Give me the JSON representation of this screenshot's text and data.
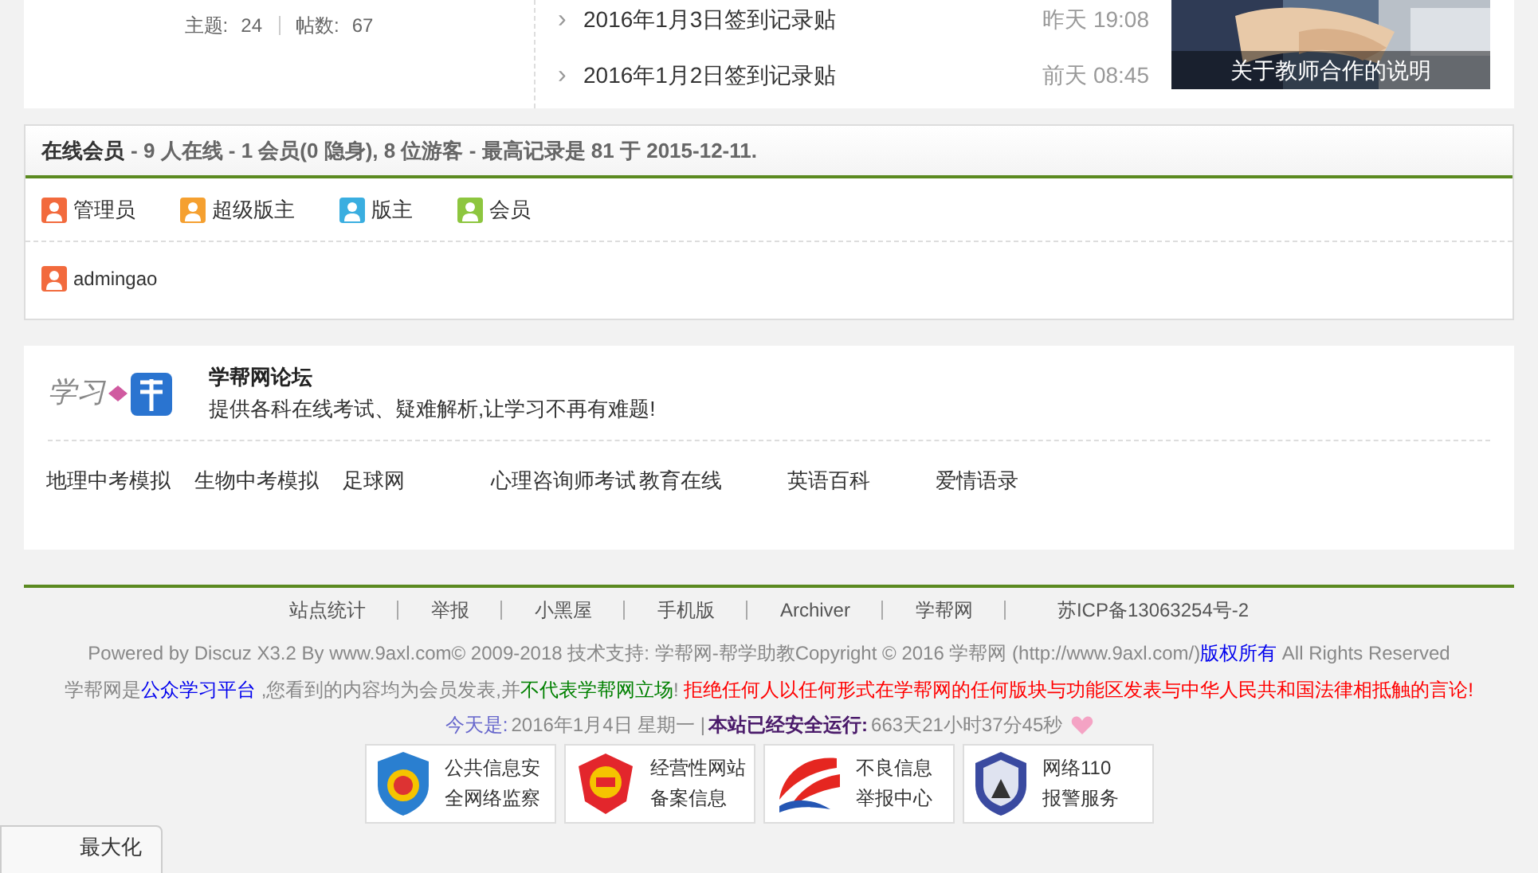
{
  "forum_stats": {
    "topics_label": "主题:",
    "topics": "24",
    "posts_label": "帖数:",
    "posts": "67"
  },
  "threads": [
    {
      "arrow": "›",
      "title": "2016年1月3日签到记录贴",
      "time": "昨天 19:08"
    },
    {
      "arrow": "›",
      "title": "2016年1月2日签到记录贴",
      "time": "前天 08:45"
    }
  ],
  "slide": {
    "caption": "关于教师合作的说明"
  },
  "online": {
    "title": "在线会员",
    "summary": "- 9 人在线 - 1 会员(0 隐身), 8 位游客 - 最高记录是 81 于 2015-12-11.",
    "legend": [
      {
        "label": "管理员",
        "color": "#f26a3d"
      },
      {
        "label": "超级版主",
        "color": "#f5a030"
      },
      {
        "label": "版主",
        "color": "#3aaee0"
      },
      {
        "label": "会员",
        "color": "#8dc63f"
      }
    ],
    "members": [
      {
        "name": "admingao",
        "color": "#f26a3d"
      }
    ]
  },
  "links": {
    "logo_text": "学习",
    "site_name": "学帮网论坛",
    "tagline": "提供各科在线考试、疑难解析,让学习不再有难题!",
    "items": [
      "地理中考模拟",
      "生物中考模拟",
      "足球网",
      "心理咨询师考试",
      "教育在线",
      "英语百科",
      "爱情语录"
    ]
  },
  "footer": {
    "nav": [
      "站点统计",
      "举报",
      "小黑屋",
      "手机版",
      "Archiver",
      "学帮网",
      "苏ICP备13063254号-2"
    ],
    "powered": [
      {
        "kind": "plain",
        "text": "Powered by Discuz X3.2 By www.9axl.com© 2009-2018 技术支持: 学帮网-帮学助教Copyright © 2016 学帮网 (http://www.9axl.com/)"
      },
      {
        "kind": "link",
        "text": "版权所有"
      },
      {
        "kind": "plain",
        "text": " All Rights Reserved"
      }
    ],
    "notice": [
      {
        "kind": "plain",
        "text": "学帮网是"
      },
      {
        "kind": "link",
        "text": "公众学习平台"
      },
      {
        "kind": "plain",
        "text": " ,您看到的内容均为会员发表,并"
      },
      {
        "kind": "green",
        "text": "不代表学帮网立场"
      },
      {
        "kind": "plain",
        "text": "! "
      },
      {
        "kind": "red",
        "text": "拒绝任何人以任何形式在学帮网的任何版块与功能区发表与中华人民共和国法律相抵触的言论!"
      }
    ],
    "today_label": "今天是:",
    "today": "2016年1月4日 星期一 |",
    "uptime_label": "本站已经安全运行:",
    "uptime": "663天21小时37分45秒",
    "badges": [
      {
        "kind": "shield",
        "lines": [
          "公共信息安",
          "全网络监察"
        ]
      },
      {
        "kind": "seal",
        "lines": [
          "经营性网站",
          "备案信息"
        ]
      },
      {
        "kind": "swoosh",
        "lines": [
          "不良信息",
          "举报中心"
        ]
      },
      {
        "kind": "police",
        "lines": [
          "网络110",
          "报警服务"
        ]
      }
    ]
  },
  "float_tab": {
    "label": "最大化"
  }
}
